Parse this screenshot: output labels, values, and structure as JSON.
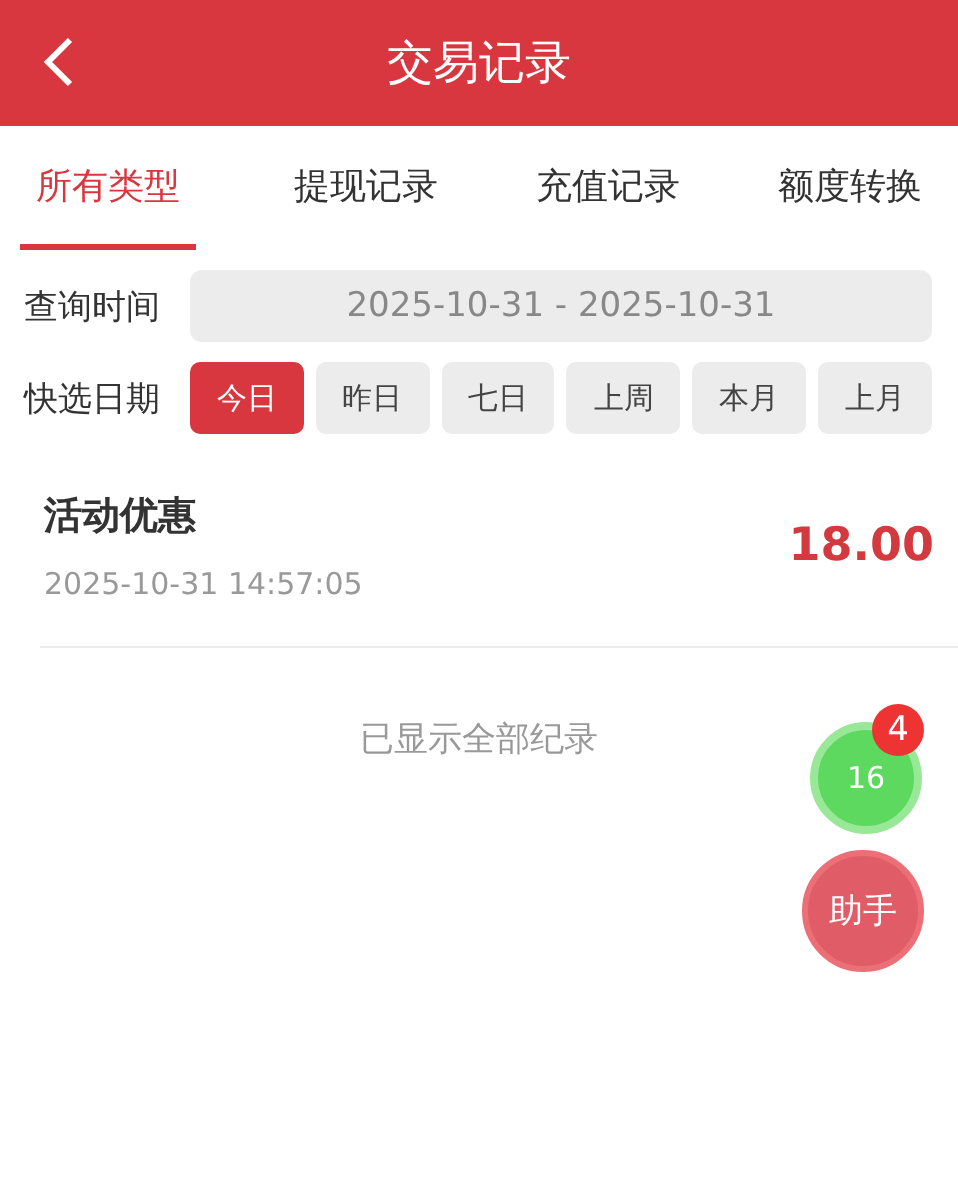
{
  "header": {
    "title": "交易记录"
  },
  "tabs": [
    {
      "label": "所有类型",
      "selected": true
    },
    {
      "label": "提现记录",
      "selected": false
    },
    {
      "label": "充值记录",
      "selected": false
    },
    {
      "label": "额度转换",
      "selected": false
    }
  ],
  "query": {
    "label": "查询时间",
    "value": "2025-10-31 - 2025-10-31"
  },
  "quick_dates": {
    "label": "快选日期",
    "options": [
      {
        "label": "今日",
        "selected": true
      },
      {
        "label": "昨日",
        "selected": false
      },
      {
        "label": "七日",
        "selected": false
      },
      {
        "label": "上周",
        "selected": false
      },
      {
        "label": "本月",
        "selected": false
      },
      {
        "label": "上月",
        "selected": false
      }
    ]
  },
  "records": [
    {
      "title": "活动优惠",
      "time": "2025-10-31 14:57:05",
      "amount": "18.00"
    }
  ],
  "footer": "已显示全部纪录",
  "float_buttons": {
    "count": "16",
    "badge": "4",
    "assistant": "助手"
  }
}
